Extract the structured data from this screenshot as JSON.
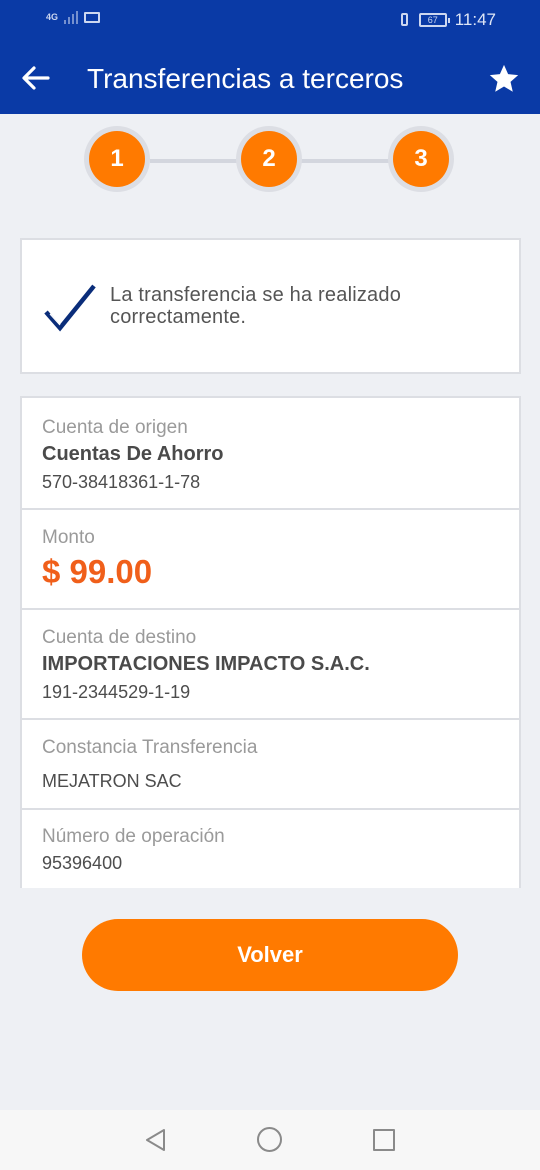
{
  "status_bar": {
    "network": "4G",
    "battery": "67",
    "time": "11:47"
  },
  "header": {
    "title": "Transferencias a terceros"
  },
  "steps": [
    "1",
    "2",
    "3"
  ],
  "success_message": "La transferencia se ha realizado correctamente.",
  "details": {
    "origin": {
      "label": "Cuenta de origen",
      "name": "Cuentas De Ahorro",
      "number": "570-38418361-1-78"
    },
    "amount": {
      "label": "Monto",
      "value": "$ 99.00"
    },
    "destination": {
      "label": "Cuenta de destino",
      "name": "IMPORTACIONES IMPACTO S.A.C.",
      "number": "191-2344529-1-19"
    },
    "receipt": {
      "label": "Constancia Transferencia",
      "value": "MEJATRON SAC"
    },
    "operation": {
      "label": "Número de operación",
      "value": "95396400"
    }
  },
  "actions": {
    "back_label": "Volver"
  },
  "colors": {
    "header": "#0a3aa6",
    "accent": "#ff7a00",
    "amount": "#f05f1a"
  },
  "icons": [
    "back-arrow-icon",
    "star-icon",
    "checkmark-icon",
    "nav-back-icon",
    "nav-home-icon",
    "nav-recent-icon"
  ]
}
